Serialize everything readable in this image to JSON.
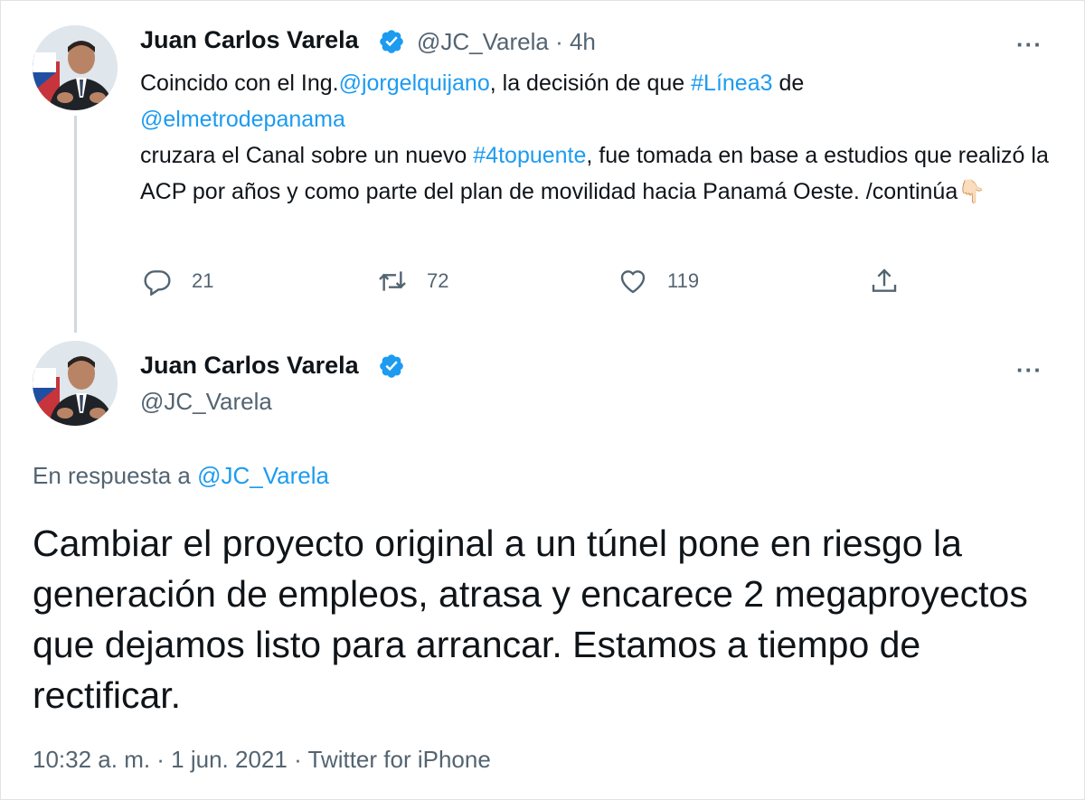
{
  "tweet1": {
    "author_name": "Juan Carlos Varela",
    "handle": "@JC_Varela",
    "separator": " · ",
    "time": "4h",
    "text_parts": {
      "p1": "Coincido con el Ing.",
      "mention1": "@jorgelquijano",
      "p2": ", la decisión de que ",
      "hashtag1": "#Línea3",
      "p3": " de",
      "mention2": "@elmetrodepanama",
      "p4": "cruzara el Canal sobre un nuevo ",
      "hashtag2": "#4topuente",
      "p5": ", fue  tomada en base a estudios que realizó la ACP por años  y como parte del plan de movilidad hacia Panamá Oeste. /continúa",
      "emoji": "👇🏻"
    },
    "reply_count": "21",
    "retweet_count": "72",
    "like_count": "119",
    "more_label": "···"
  },
  "tweet2": {
    "author_name": "Juan Carlos Varela",
    "handle": "@JC_Varela",
    "more_label": "···",
    "reply_to_prefix": "En respuesta a ",
    "reply_to_handle": "@JC_Varela",
    "text": "Cambiar el proyecto original a un túnel pone en riesgo la generación de empleos, atrasa y encarece 2 megaproyectos que dejamos listo para arrancar. Estamos a tiempo de rectificar.",
    "meta": "10:32 a. m. · 1 jun. 2021 · Twitter for iPhone"
  },
  "colors": {
    "accent": "#1d9bf0",
    "secondary_text": "#536471",
    "primary_text": "#0f1419"
  },
  "icons": [
    "verified-badge-icon",
    "reply-icon",
    "retweet-icon",
    "like-icon",
    "share-icon",
    "more-icon"
  ]
}
